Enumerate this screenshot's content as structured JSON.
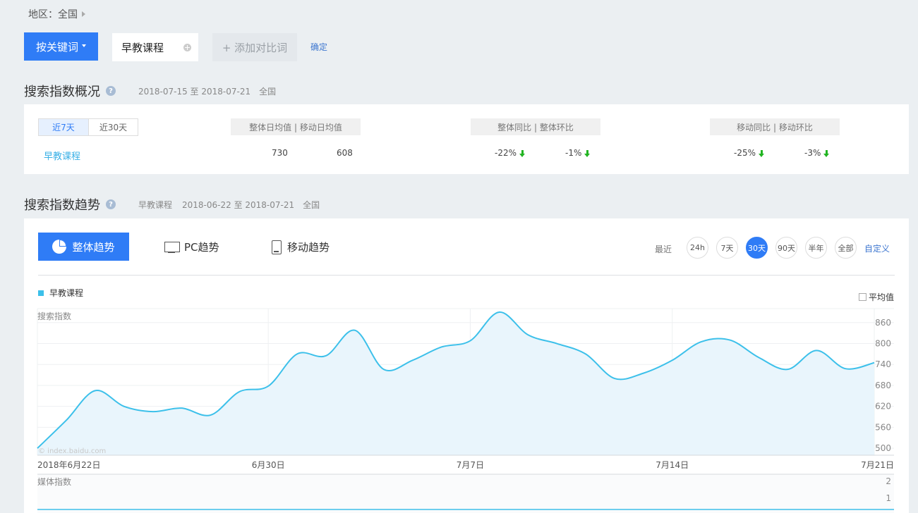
{
  "region": {
    "label": "地区：全国"
  },
  "keyword_bar": {
    "mode_button": "按关键词",
    "keyword": "早教课程",
    "add_compare": "+ 添加对比词",
    "confirm": "确定"
  },
  "overview": {
    "title": "搜索指数概况",
    "date_range": "2018-07-15 至 2018-07-21",
    "region": "全国",
    "range_tabs": [
      "近7天",
      "近30天"
    ],
    "headers": {
      "avg": "整体日均值   |   移动日均值",
      "overall_change": "整体同比   |   整体环比",
      "mobile_change": "移动同比   |   移动环比"
    },
    "row": {
      "keyword": "早教课程",
      "overall_avg": "730",
      "mobile_avg": "608",
      "overall_yoy": "-22%",
      "overall_mom": "-1%",
      "mobile_yoy": "-25%",
      "mobile_mom": "-3%"
    }
  },
  "trend": {
    "title": "搜索指数趋势",
    "keyword": "早教课程",
    "date_range": "2018-06-22 至 2018-07-21",
    "region": "全国",
    "tabs": {
      "total": "整体趋势",
      "pc": "PC趋势",
      "mobile": "移动趋势"
    },
    "recent_label": "最近",
    "ranges": [
      "24h",
      "7天",
      "30天",
      "90天",
      "半年",
      "全部"
    ],
    "active_range": "30天",
    "custom": "自定义",
    "legend": "早教课程",
    "avg_toggle": "平均值",
    "search_index_label": "搜索指数",
    "media_index_label": "媒体指数",
    "watermark": "© index.baidu.com"
  },
  "colors": {
    "accent": "#2f7cf6",
    "series": "#3cc0ea",
    "down": "#22b422"
  },
  "chart_data": {
    "type": "area",
    "ylabel": "搜索指数",
    "yticks": [
      500,
      560,
      620,
      680,
      740,
      800,
      860
    ],
    "ylim": [
      480,
      900
    ],
    "x_tick_labels": [
      {
        "index": 0,
        "label": "2018年6月22日"
      },
      {
        "index": 8,
        "label": "6月30日"
      },
      {
        "index": 15,
        "label": "7月7日"
      },
      {
        "index": 22,
        "label": "7月14日"
      },
      {
        "index": 29,
        "label": "7月21日"
      }
    ],
    "series": [
      {
        "name": "早教课程",
        "values": [
          500,
          580,
          665,
          620,
          605,
          615,
          595,
          662,
          678,
          770,
          765,
          838,
          726,
          752,
          790,
          808,
          890,
          825,
          800,
          770,
          700,
          715,
          752,
          805,
          810,
          760,
          726,
          780,
          728,
          745
        ]
      }
    ],
    "media_chart": {
      "ylabel": "媒体指数",
      "yticks": [
        1,
        2
      ]
    }
  }
}
